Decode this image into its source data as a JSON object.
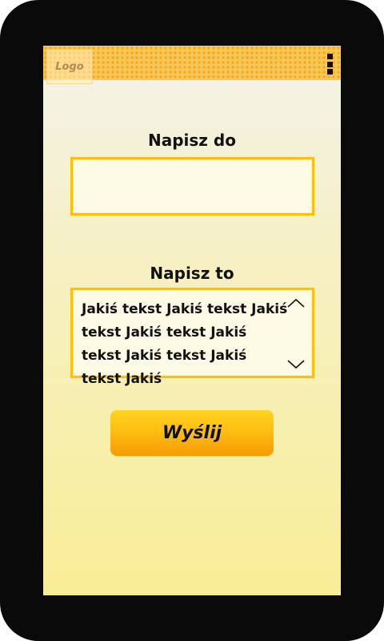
{
  "header": {
    "logo_text": "Logo",
    "menu_icon": "vertical-dots-icon"
  },
  "form": {
    "to_label": "Napisz do",
    "to_value": "",
    "message_label": "Napisz to",
    "message_value": "Jakiś tekst Jakiś tekst Jakiś tekst Jakiś tekst Jakiś tekst Jakiś tekst Jakiś tekst Jakiś",
    "scroll_up_icon": "chevron-up-icon",
    "scroll_down_icon": "chevron-down-icon",
    "send_label": "Wyślij"
  },
  "colors": {
    "accent": "#ffc00c",
    "header_dots": "#f9a915",
    "device_frame": "#0a0a0a"
  }
}
